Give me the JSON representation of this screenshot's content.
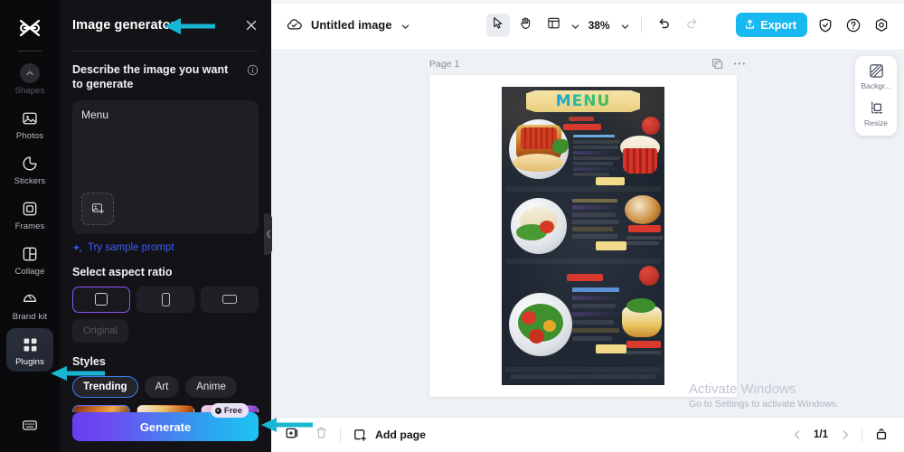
{
  "rail": {
    "logo_icon": "capcut-logo-icon",
    "scroll_up_icon": "chevron-up-icon",
    "items": [
      {
        "label": "Shapes",
        "icon": "shapes-icon",
        "state": "dimmed"
      },
      {
        "label": "Photos",
        "icon": "photo-icon",
        "state": "normal"
      },
      {
        "label": "Stickers",
        "icon": "sticker-icon",
        "state": "normal"
      },
      {
        "label": "Frames",
        "icon": "frame-icon",
        "state": "normal"
      },
      {
        "label": "Collage",
        "icon": "collage-icon",
        "state": "normal"
      },
      {
        "label": "Brand kit",
        "icon": "brandkit-icon",
        "state": "normal"
      },
      {
        "label": "Plugins",
        "icon": "plugins-grid-icon",
        "state": "active"
      }
    ],
    "bottom_icon": "keyboard-shortcuts-icon"
  },
  "panel": {
    "title": "Image generator",
    "close_icon": "close-icon",
    "describe_label": "Describe the image you want to generate",
    "info_icon": "info-icon",
    "prompt_value": "Menu",
    "prompt_placeholder": "Describe the image you want to generate",
    "upload_icon": "add-image-icon",
    "sample_prompt_label": "Try sample prompt",
    "sample_prompt_icon": "sparkle-icon",
    "aspect_ratio_label": "Select aspect ratio",
    "aspect_ratios": [
      {
        "name": "square",
        "icon": "square-icon",
        "selected": true
      },
      {
        "name": "portrait",
        "icon": "portrait-icon",
        "selected": false
      },
      {
        "name": "landscape",
        "icon": "landscape-icon",
        "selected": false
      }
    ],
    "original_label": "Original",
    "styles_label": "Styles",
    "style_tabs": [
      {
        "label": "Trending",
        "selected": true
      },
      {
        "label": "Art",
        "selected": false
      },
      {
        "label": "Anime",
        "selected": false
      }
    ],
    "style_thumbs": [
      {
        "name": "trending-thumb-1",
        "selected": true
      },
      {
        "name": "trending-thumb-2",
        "selected": false
      },
      {
        "name": "trending-thumb-3",
        "selected": false
      }
    ],
    "generate_label": "Generate",
    "free_badge_label": "Free",
    "collapse_icon": "chevron-left-icon"
  },
  "topbar": {
    "cloud_icon": "cloud-saved-icon",
    "doc_title": "Untitled image",
    "title_chevron_icon": "chevron-down-icon",
    "tools": [
      {
        "name": "select-tool",
        "icon": "cursor-arrow-icon",
        "active": true
      },
      {
        "name": "hand-tool",
        "icon": "hand-icon",
        "active": false
      },
      {
        "name": "layout-tool",
        "icon": "layout-panel-icon",
        "active": false
      }
    ],
    "layout_chevron_icon": "chevron-down-icon",
    "zoom_value": "38%",
    "zoom_chevron_icon": "chevron-down-icon",
    "undo_icon": "undo-icon",
    "redo_icon": "redo-icon",
    "export_label": "Export",
    "export_icon": "upload-icon",
    "export_color": "#17b9f0",
    "shield_icon": "shield-check-icon",
    "help_icon": "question-circle-icon",
    "settings_icon": "gear-icon"
  },
  "canvas": {
    "page_label": "Page 1",
    "page_duplicate_icon": "duplicate-page-icon",
    "page_more_icon": "more-options-icon",
    "artwork": {
      "name": "generated-menu-poster",
      "headline": "MENU"
    },
    "right_tools": [
      {
        "label": "Backgr...",
        "icon": "background-remove-icon",
        "name": "background-tool"
      },
      {
        "label": "Resize",
        "icon": "resize-icon",
        "name": "resize-tool"
      }
    ],
    "watermark_line1": "Activate Windows",
    "watermark_line2": "Go to Settings to activate Windows."
  },
  "bottombar": {
    "duplicate_icon": "duplicate-icon",
    "delete_icon": "trash-icon",
    "add_page_label": "Add page",
    "add_page_icon": "add-page-icon",
    "prev_page_icon": "chevron-left-icon",
    "page_indicator": "1/1",
    "next_page_icon": "chevron-right-icon",
    "timeline_icon": "pages-panel-icon"
  },
  "annotations": {
    "arrow_color": "#19b6d4",
    "arrows": [
      {
        "name": "arrow-to-panel-title"
      },
      {
        "name": "arrow-to-plugins"
      },
      {
        "name": "arrow-to-generate"
      }
    ]
  }
}
